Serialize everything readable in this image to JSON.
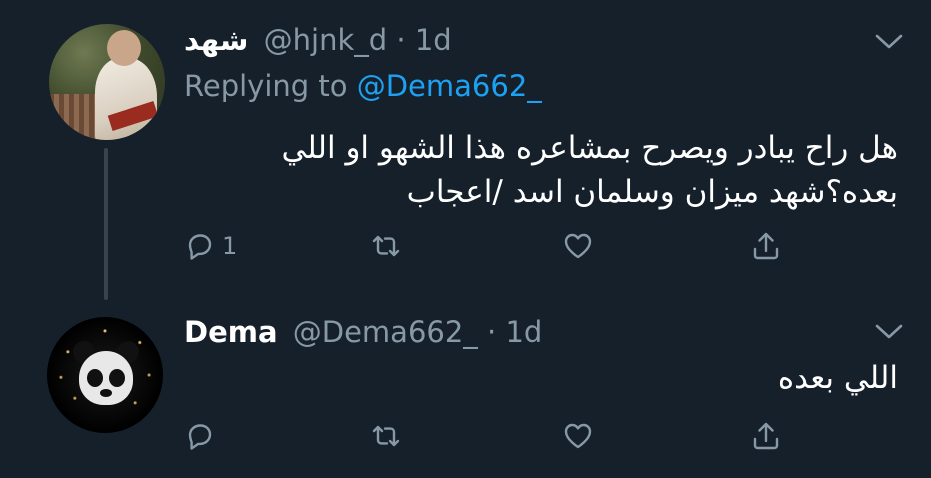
{
  "tweets": [
    {
      "display_name": "شهد",
      "handle": "@hjnk_d",
      "separator": "·",
      "time": "1d",
      "replying_prefix": "Replying to",
      "replying_mention": "@Dema662_",
      "text_line1": "هل راح يبادر ويصرح بمشاعره هذا الشهو او اللي",
      "text_line2": "بعده؟شهد ميزان وسلمان اسد /اعجاب",
      "reply_count": "1",
      "avatar_icon": "user-photo-avatar"
    },
    {
      "display_name": "Dema",
      "handle": "@Dema662_",
      "separator": "·",
      "time": "1d",
      "text_line1": "اللي بعده",
      "reply_count": "",
      "avatar_icon": "panda-avatar"
    }
  ],
  "colors": {
    "background": "#15202b",
    "text_primary": "#ffffff",
    "text_secondary": "#8899a6",
    "accent": "#1da1f2",
    "thread_line": "#38444d"
  },
  "icons": [
    "reply-icon",
    "retweet-icon",
    "like-icon",
    "share-icon",
    "chevron-down-icon"
  ]
}
